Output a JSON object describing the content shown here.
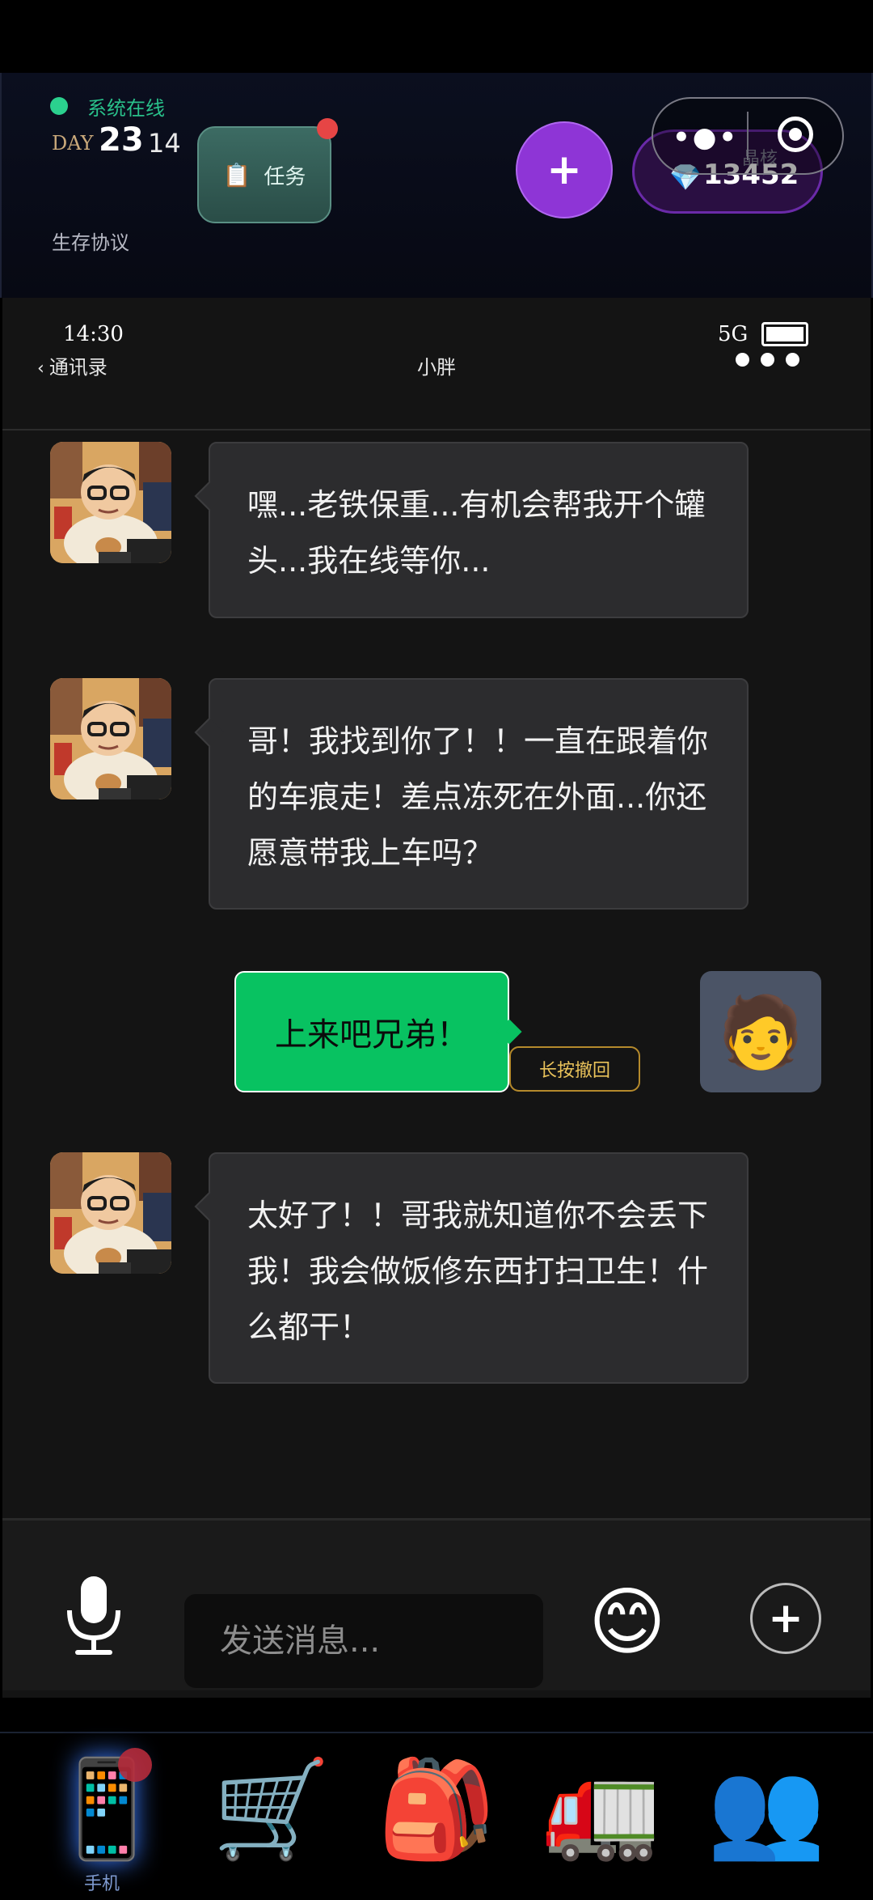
{
  "hud": {
    "status_text": "系统在线",
    "day_label": "DAY",
    "day_number": "23",
    "day_hour": "14",
    "task_label": "任务",
    "protocol_label": "生存协议",
    "plus_label": "+",
    "gem_value": "13452",
    "crystal_label": "晶核",
    "capsule_dots": "•●•"
  },
  "phone": {
    "time": "14:30",
    "network": "5G",
    "back_label": "通讯录",
    "chat_title": "小胖"
  },
  "messages": [
    {
      "from": "contact",
      "text": "嘿...老铁保重...有机会帮我开个罐头...我在线等你..."
    },
    {
      "from": "contact",
      "text": "哥！我找到你了！！一直在跟着你的车痕走！差点冻死在外面...你还愿意带我上车吗？"
    },
    {
      "from": "self",
      "text": "上来吧兄弟！",
      "recall_label": "长按撤回"
    },
    {
      "from": "contact",
      "text": "太好了！！哥我就知道你不会丢下我！我会做饭修东西打扫卫生！什么都干！"
    }
  ],
  "input": {
    "placeholder": "发送消息...",
    "emoji": "😊",
    "add": "+"
  },
  "nav": {
    "items": [
      {
        "icon": "📱",
        "label": "手机"
      },
      {
        "icon": "🛒"
      },
      {
        "icon": "🎒"
      },
      {
        "icon": "🚛"
      },
      {
        "icon": "👥"
      }
    ]
  },
  "colors": {
    "accent_green": "#08c261",
    "accent_purple": "#8e35d6",
    "status_green": "#2bd08e"
  }
}
